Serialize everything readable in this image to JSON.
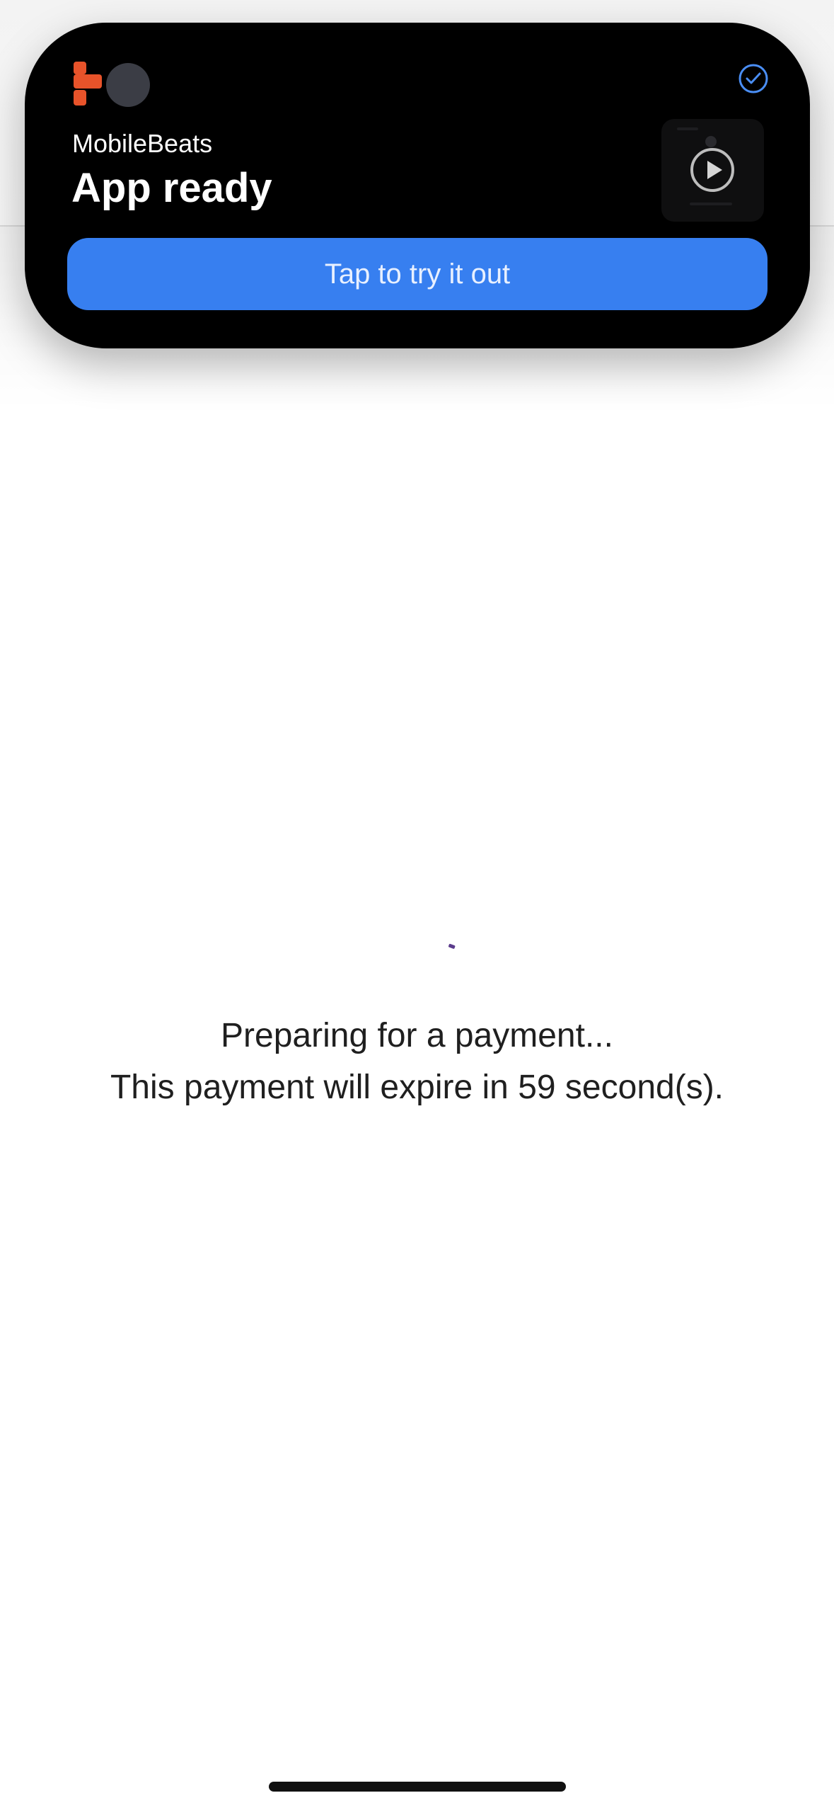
{
  "notification": {
    "app_name": "MobileBeats",
    "title": "App ready",
    "button_label": "Tap to try it out",
    "logo_icon": "app-logo-icon",
    "status_icon": "checkmark-circle-icon",
    "preview_icon": "play-icon"
  },
  "main": {
    "status_line": "Preparing for a payment...",
    "expiry_line": "This payment will expire in 59 second(s)."
  },
  "colors": {
    "button_blue": "#377ff0",
    "logo_orange": "#e8532a",
    "spinner_purple": "#5b3c8c",
    "check_blue": "#4a8ef5"
  }
}
